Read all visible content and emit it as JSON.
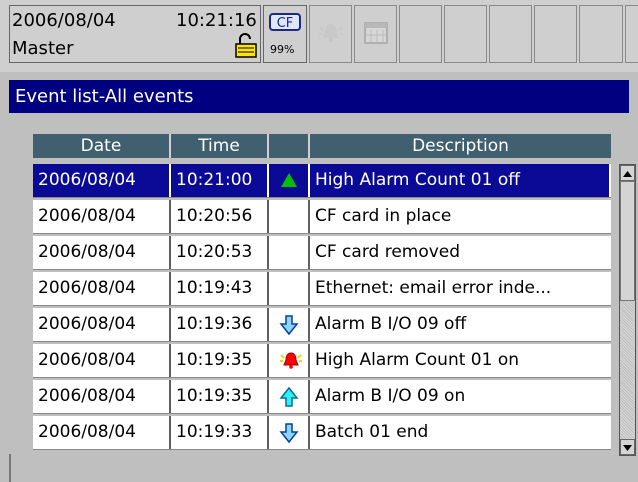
{
  "status": {
    "date": "2006/08/04",
    "time": "10:21:16",
    "user": "Master",
    "cf_label": "CF",
    "cf_percent": "99%"
  },
  "title": "Event list-All events",
  "table": {
    "columns": [
      "Date",
      "Time",
      "",
      "Description"
    ],
    "rows": [
      {
        "date": "2006/08/04",
        "time": "10:21:00",
        "icon": "green-up-triangle-icon",
        "desc": "High Alarm Count 01 off",
        "selected": true
      },
      {
        "date": "2006/08/04",
        "time": "10:20:56",
        "icon": "",
        "desc": "CF card in place"
      },
      {
        "date": "2006/08/04",
        "time": "10:20:53",
        "icon": "",
        "desc": "CF card removed"
      },
      {
        "date": "2006/08/04",
        "time": "10:19:43",
        "icon": "",
        "desc": "Ethernet: email error inde..."
      },
      {
        "date": "2006/08/04",
        "time": "10:19:36",
        "icon": "blue-down-arrow-icon",
        "desc": "Alarm B I/O 09 off"
      },
      {
        "date": "2006/08/04",
        "time": "10:19:35",
        "icon": "red-alarm-bell-icon",
        "desc": "High Alarm Count 01 on"
      },
      {
        "date": "2006/08/04",
        "time": "10:19:35",
        "icon": "cyan-up-arrow-icon",
        "desc": "Alarm B I/O 09 on"
      },
      {
        "date": "2006/08/04",
        "time": "10:19:33",
        "icon": "blue-down-arrow-icon",
        "desc": "Batch 01 end"
      }
    ]
  }
}
